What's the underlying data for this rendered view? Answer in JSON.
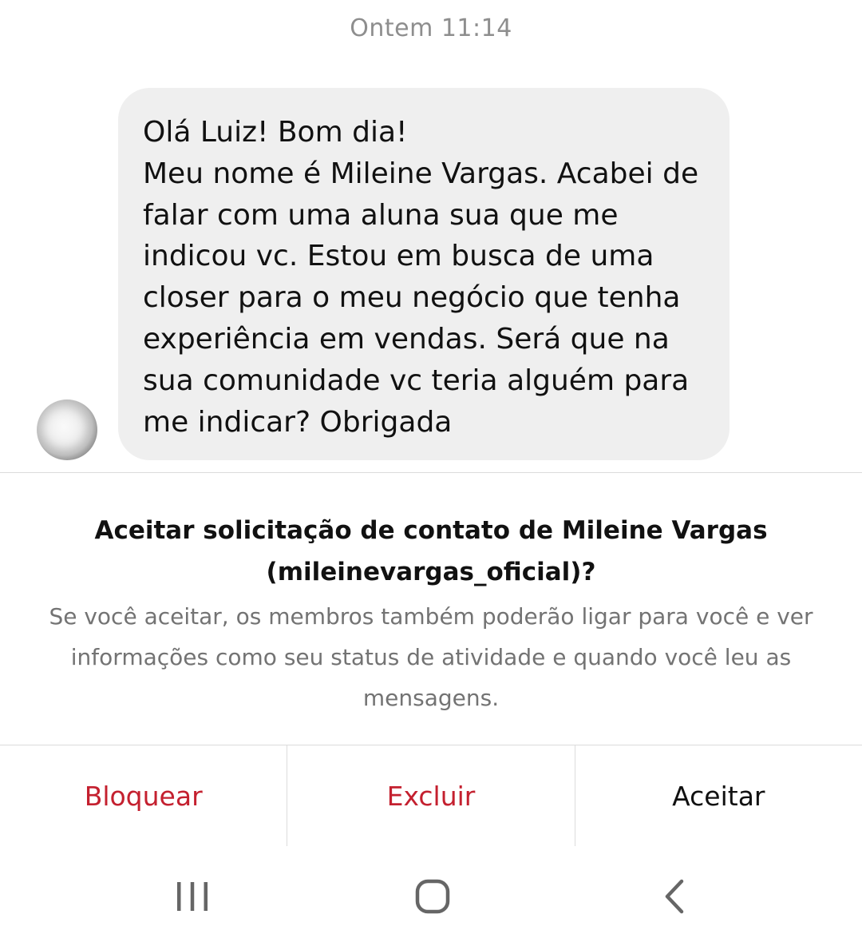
{
  "timestamp": "Ontem 11:14",
  "message": {
    "text": "Olá Luiz! Bom dia!\nMeu nome é Mileine Vargas. Acabei de falar com uma aluna sua que me indicou vc. Estou em busca de uma closer para o meu negócio que tenha experiência em vendas. Será que na sua comunidade vc teria alguém para me indicar? Obrigada"
  },
  "request": {
    "title": "Aceitar solicitação de contato de Mileine Vargas (mileinevargas_oficial)?",
    "description": "Se você aceitar, os membros também poderão ligar para você e ver informações como seu status de atividade e quando você leu as mensagens."
  },
  "actions": {
    "block_label": "Bloquear",
    "delete_label": "Excluir",
    "accept_label": "Aceitar"
  },
  "colors": {
    "destructive": "#c4202f",
    "bubble": "#efefef",
    "secondary_text": "#737373"
  },
  "icons": {
    "recents": "recent-apps-icon",
    "home": "home-icon",
    "back": "back-icon"
  }
}
